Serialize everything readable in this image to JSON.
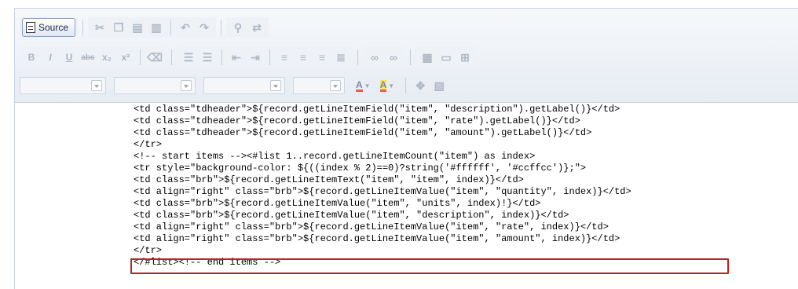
{
  "toolbar": {
    "source_label": "Source",
    "row1_icons": [
      "cut-icon",
      "copy-icon",
      "paste-icon",
      "paste-word-icon",
      "undo-icon",
      "redo-icon",
      "find-icon",
      "replace-icon"
    ],
    "format_buttons": {
      "bold": "B",
      "italic": "I",
      "underline": "U",
      "strike": "abc",
      "subscript": "x₂",
      "superscript": "x²"
    },
    "font_color_label": "A",
    "bg_color_label": "A"
  },
  "code_lines": [
    "<td class=\"tdheader\">${record.getLineItemField(\"item\", \"description\").getLabel()}</td>",
    "<td class=\"tdheader\">${record.getLineItemField(\"item\", \"rate\").getLabel()}</td>",
    "<td class=\"tdheader\">${record.getLineItemField(\"item\", \"amount\").getLabel()}</td>",
    "</tr>",
    "<!-- start items --><#list 1..record.getLineItemCount(\"item\") as index>",
    "<tr style=\"background-color: ${((index % 2)==0)?string('#ffffff', '#ccffcc')};\">",
    "<td class=\"brb\">${record.getLineItemText(\"item\", \"item\", index)}</td>",
    "<td align=\"right\" class=\"brb\">${record.getLineItemValue(\"item\", \"quantity\", index)}</td>",
    "<td class=\"brb\">${record.getLineItemValue(\"item\", \"units\", index)!}</td>",
    "<td class=\"brb\">${record.getLineItemValue(\"item\", \"description\", index)}</td>",
    "<td align=\"right\" class=\"brb\">${record.getLineItemValue(\"item\", \"rate\", index)}</td>",
    "<td align=\"right\" class=\"brb\">${record.getLineItemValue(\"item\", \"amount\", index)}</td>",
    "</tr>",
    "</#list><!-- end items -->"
  ],
  "highlight_color": "#b4262a"
}
